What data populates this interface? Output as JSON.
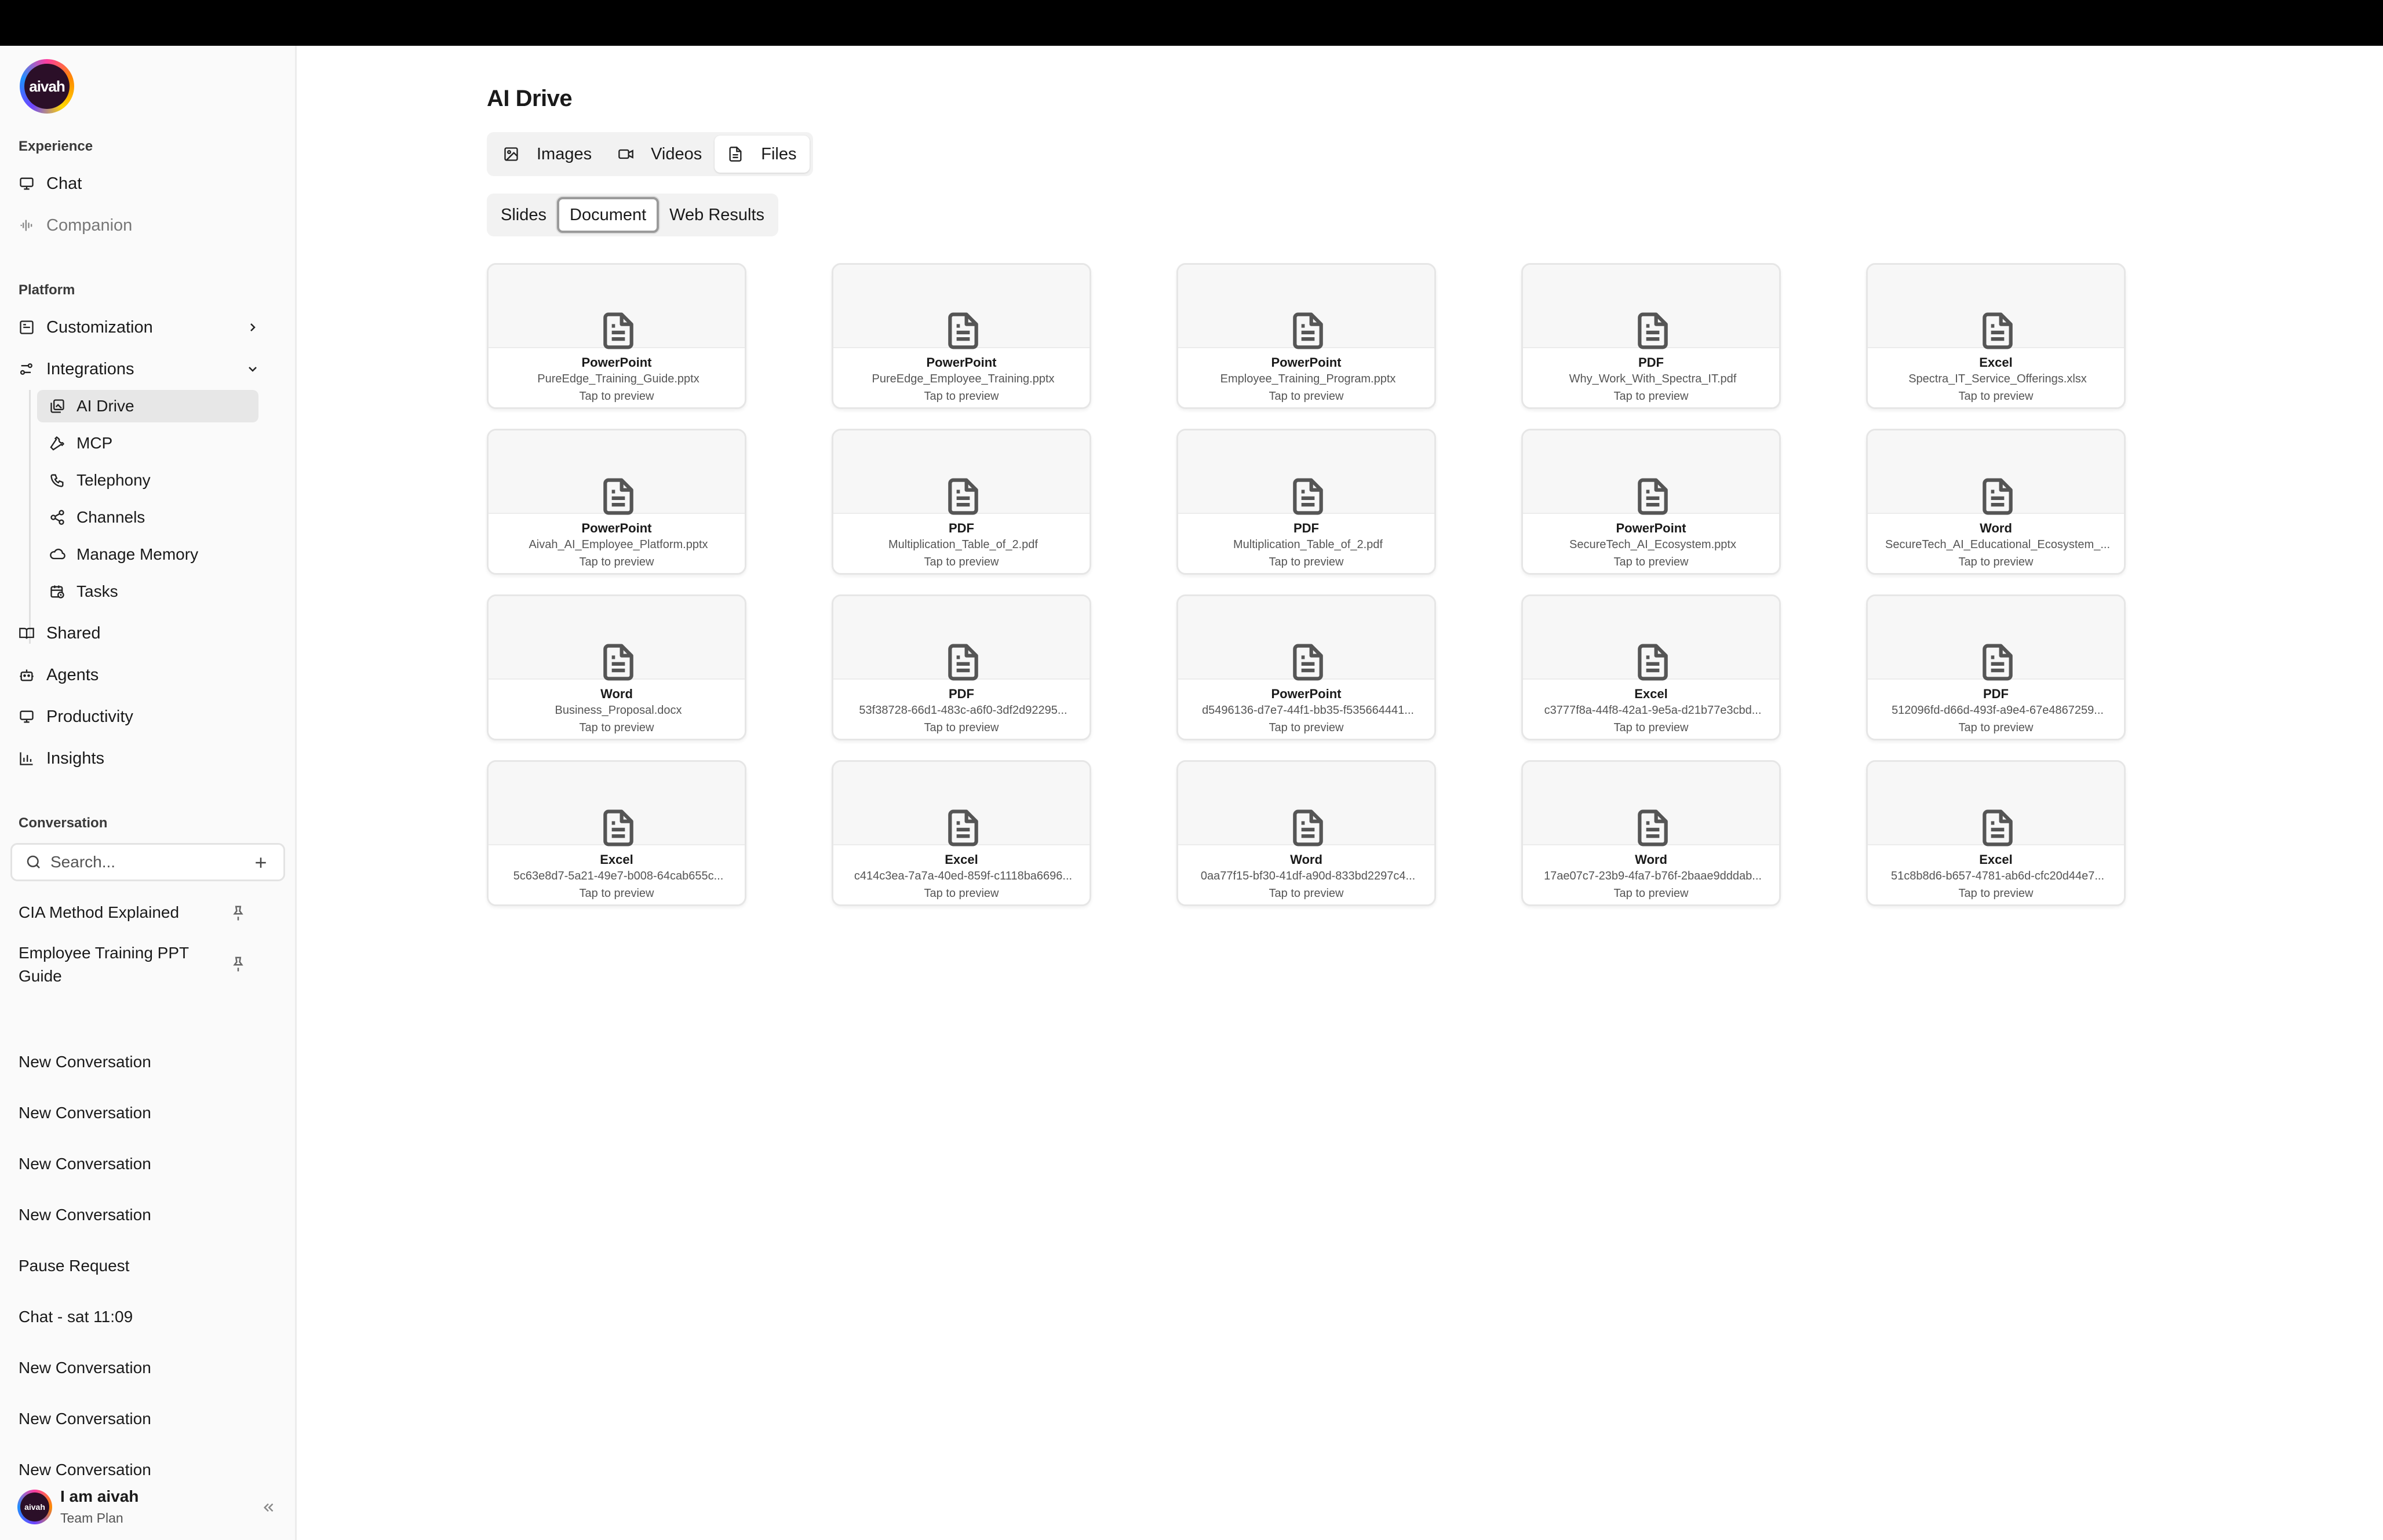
{
  "brand": {
    "logo_text": "aivah"
  },
  "sidebar": {
    "experience_label": "Experience",
    "chat": "Chat",
    "companion": "Companion",
    "platform_label": "Platform",
    "customization": "Customization",
    "integrations": "Integrations",
    "integration_items": [
      "AI Drive",
      "MCP",
      "Telephony",
      "Channels",
      "Manage Memory",
      "Tasks"
    ],
    "shared": "Shared",
    "agents": "Agents",
    "productivity": "Productivity",
    "insights": "Insights",
    "conversation_label": "Conversation",
    "search_placeholder": "Search...",
    "conversations": [
      "CIA Method Explained",
      "Employee Training PPT Guide",
      "New Conversation",
      "New Conversation",
      "New Conversation",
      "New Conversation",
      "Pause Request",
      "Chat - sat 11:09",
      "New Conversation",
      "New Conversation",
      "New Conversation"
    ],
    "user": {
      "avatar_text": "aivah",
      "name": "I am aivah",
      "plan": "Team Plan"
    }
  },
  "main": {
    "title": "AI Drive",
    "media_tabs": [
      "Images",
      "Videos",
      "Files"
    ],
    "active_media_tab": "Files",
    "file_tabs": [
      "Slides",
      "Document",
      "Web Results"
    ],
    "active_file_tab": "Document",
    "tap_hint": "Tap to preview",
    "files": [
      {
        "type": "PowerPoint",
        "name": "PureEdge_Training_Guide.pptx"
      },
      {
        "type": "PowerPoint",
        "name": "PureEdge_Employee_Training.pptx"
      },
      {
        "type": "PowerPoint",
        "name": "Employee_Training_Program.pptx"
      },
      {
        "type": "PDF",
        "name": "Why_Work_With_Spectra_IT.pdf"
      },
      {
        "type": "Excel",
        "name": "Spectra_IT_Service_Offerings.xlsx"
      },
      {
        "type": "PowerPoint",
        "name": "Aivah_AI_Employee_Platform.pptx"
      },
      {
        "type": "PDF",
        "name": "Multiplication_Table_of_2.pdf"
      },
      {
        "type": "PDF",
        "name": "Multiplication_Table_of_2.pdf"
      },
      {
        "type": "PowerPoint",
        "name": "SecureTech_AI_Ecosystem.pptx"
      },
      {
        "type": "Word",
        "name": "SecureTech_AI_Educational_Ecosystem_..."
      },
      {
        "type": "Word",
        "name": "Business_Proposal.docx"
      },
      {
        "type": "PDF",
        "name": "53f38728-66d1-483c-a6f0-3df2d92295..."
      },
      {
        "type": "PowerPoint",
        "name": "d5496136-d7e7-44f1-bb35-f535664441..."
      },
      {
        "type": "Excel",
        "name": "c3777f8a-44f8-42a1-9e5a-d21b77e3cbd..."
      },
      {
        "type": "PDF",
        "name": "512096fd-d66d-493f-a9e4-67e4867259..."
      },
      {
        "type": "Excel",
        "name": "5c63e8d7-5a21-49e7-b008-64cab655c..."
      },
      {
        "type": "Excel",
        "name": "c414c3ea-7a7a-40ed-859f-c1118ba6696..."
      },
      {
        "type": "Word",
        "name": "0aa77f15-bf30-41df-a90d-833bd2297c4..."
      },
      {
        "type": "Word",
        "name": "17ae07c7-23b9-4fa7-b76f-2baae9dddab..."
      },
      {
        "type": "Excel",
        "name": "51c8b8d6-b657-4781-ab6d-cfc20d44e7..."
      }
    ]
  }
}
